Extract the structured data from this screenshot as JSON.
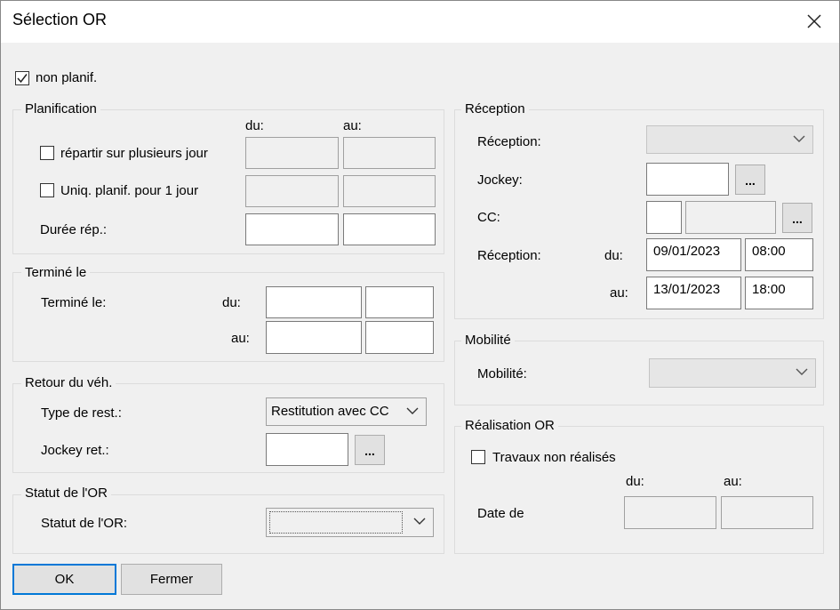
{
  "dialog": {
    "title": "Sélection OR",
    "close_icon": "close-icon"
  },
  "non_planif": {
    "label": "non planif.",
    "checked": true
  },
  "planification": {
    "title": "Planification",
    "col_du": "du:",
    "col_au": "au:",
    "repartir_label": "répartir sur plusieurs jour",
    "uniq_label": "Uniq. planif. pour 1 jour",
    "duree_label": "Durée rép.:"
  },
  "termine": {
    "title": "Terminé le",
    "label": "Terminé le:",
    "du": "du:",
    "au": "au:"
  },
  "retour": {
    "title": "Retour du véh.",
    "type_label": "Type de rest.:",
    "type_value": "Restitution avec CC",
    "jockey_label": "Jockey ret.:",
    "dots": "..."
  },
  "statut": {
    "title": "Statut de l'OR",
    "label": "Statut de l'OR:",
    "value": ""
  },
  "reception": {
    "title": "Réception",
    "reception_label": "Réception:",
    "jockey_label": "Jockey:",
    "cc_label": "CC:",
    "dates_label": "Réception:",
    "du": "du:",
    "au": "au:",
    "du_date": "09/01/2023",
    "du_time": "08:00",
    "au_date": "13/01/2023",
    "au_time": "18:00",
    "dots": "..."
  },
  "mobilite": {
    "title": "Mobilité",
    "label": "Mobilité:"
  },
  "realisation": {
    "title": "Réalisation OR",
    "travaux_label": "Travaux non réalisés",
    "col_du": "du:",
    "col_au": "au:",
    "date_label": "Date de"
  },
  "buttons": {
    "ok": "OK",
    "fermer": "Fermer"
  }
}
